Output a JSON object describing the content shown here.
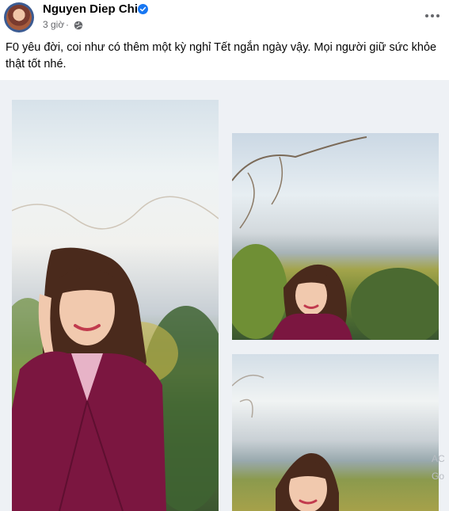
{
  "post": {
    "author": "Nguyen Diep Chi",
    "time": "3 giờ",
    "separator": "·",
    "text": "F0 yêu đời, coi như có thêm một kỳ nghỉ Tết ngắn ngày vậy. Mọi người giữ sức khỏe thật tốt nhé.",
    "icons": {
      "verified": "verified-badge-icon",
      "privacy": "globe-icon",
      "more": "more-options-icon"
    }
  },
  "colors": {
    "verified": "#1877f2",
    "name": "#050505",
    "meta": "#65676b",
    "photo_background": "#eef1f5"
  },
  "watermark": {
    "line1": "AC",
    "line2": "Go"
  }
}
